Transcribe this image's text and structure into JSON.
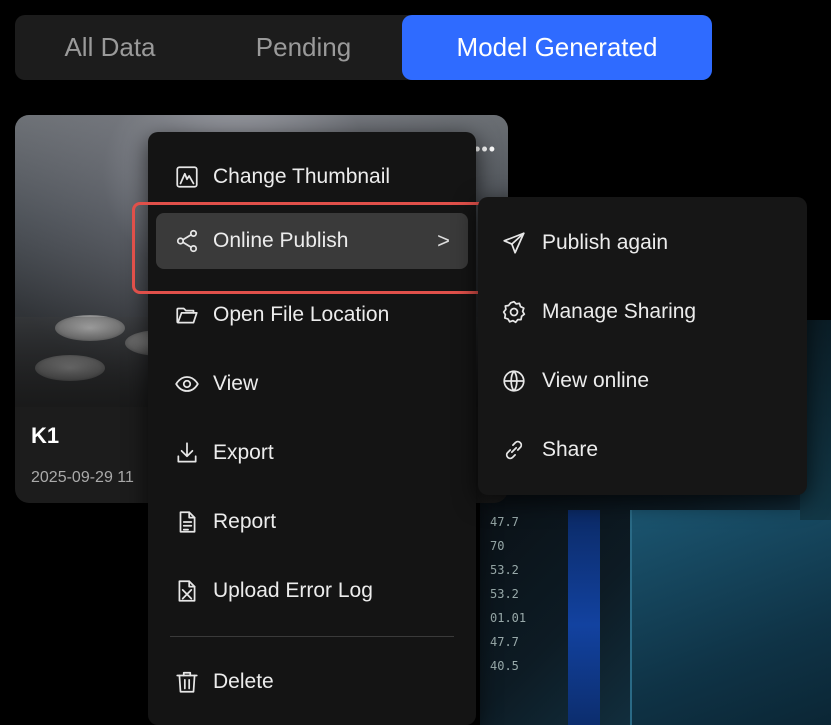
{
  "tabs": [
    {
      "label": "All Data"
    },
    {
      "label": "Pending"
    },
    {
      "label": "Model Generated"
    }
  ],
  "active_tab_color": "#2f6bff",
  "card": {
    "title": "K1",
    "date": "2025-09-29 11"
  },
  "menu": {
    "items": [
      {
        "label": "Change Thumbnail",
        "icon": "image-icon"
      },
      {
        "label": "Online Publish",
        "icon": "share-nodes-icon",
        "chevron": ">"
      },
      {
        "label": "Open File Location",
        "icon": "folder-icon"
      },
      {
        "label": "View",
        "icon": "eye-icon"
      },
      {
        "label": "Export",
        "icon": "download-icon"
      },
      {
        "label": "Report",
        "icon": "document-icon"
      },
      {
        "label": "Upload Error Log",
        "icon": "file-x-icon"
      },
      {
        "label": "Delete",
        "icon": "trash-icon"
      }
    ]
  },
  "submenu": {
    "items": [
      {
        "label": "Publish again",
        "icon": "send-icon"
      },
      {
        "label": "Manage Sharing",
        "icon": "gear-icon"
      },
      {
        "label": "View online",
        "icon": "globe-icon"
      },
      {
        "label": "Share",
        "icon": "link-icon"
      }
    ]
  },
  "highlight_color": "#e0504a",
  "scene_numbers": [
    "47.7",
    "70",
    "53.2",
    "53.2",
    "01.01",
    "47.7",
    "40.5"
  ]
}
